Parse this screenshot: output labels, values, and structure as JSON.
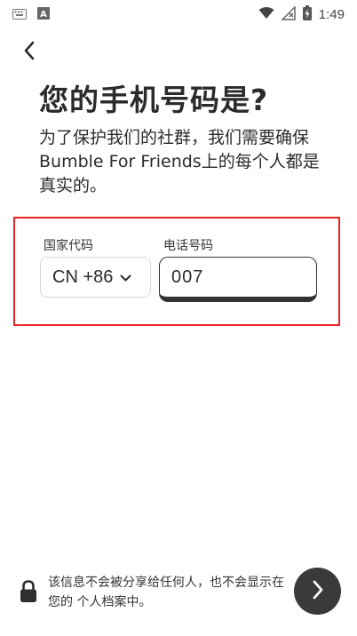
{
  "status_bar": {
    "time": "1:49",
    "left_icons": [
      "keyboard-icon",
      "font-a-icon"
    ],
    "right_icons": [
      "wifi-icon",
      "no-signal-icon",
      "battery-charging-icon"
    ]
  },
  "page": {
    "title": "您的手机号码是?",
    "subtitle": "为了保护我们的社群，我们需要确保Bumble For Friends上的每个人都是真实的。"
  },
  "form": {
    "country_code_label": "国家代码",
    "country_code_value": "CN +86",
    "phone_label": "电话号码",
    "phone_value": "007"
  },
  "footer": {
    "privacy_note": "该信息不会被分享给任何人，也不会显示在您的 个人档案中。",
    "lock_icon": "lock-icon",
    "next_icon": "chevron-right-icon"
  },
  "colors": {
    "highlight_border": "#ee2222",
    "text_primary": "#2b2b2b",
    "next_button_bg": "#3a3a3a"
  }
}
